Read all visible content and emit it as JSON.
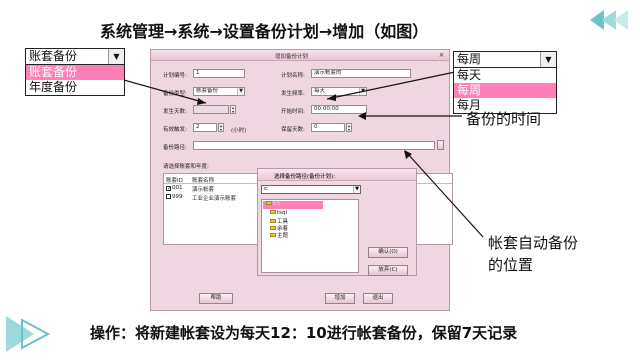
{
  "title": "系统管理→系统→设置备份计划→增加（如图）",
  "footer": "操作：将新建帐套设为每天12：10进行帐套备份，保留7天记录",
  "annotations": {
    "backup_time": "备份的时间",
    "backup_location_line1": "帐套自动备份",
    "backup_location_line2": "的位置"
  },
  "type_dropdown": {
    "selected": "账套备份",
    "options": [
      {
        "label": "账套备份",
        "selected": true
      },
      {
        "label": "年度备份",
        "selected": false
      }
    ]
  },
  "freq_dropdown": {
    "selected": "每周",
    "options": [
      {
        "label": "每天",
        "selected": false
      },
      {
        "label": "每周",
        "selected": true
      },
      {
        "label": "每月",
        "selected": false
      }
    ]
  },
  "dialog": {
    "title": "增加备份计划",
    "close": "×",
    "plan_code_label": "计划编号:",
    "plan_code_value": "1",
    "plan_name_label": "计划名称:",
    "plan_name_value": "演示帐套的",
    "backup_type_label": "备份类型:",
    "backup_type_value": "账套备份",
    "freq_label": "发生频率:",
    "freq_value": "每天",
    "days_label": "发生天数:",
    "days_value": "",
    "start_time_label": "开始时间:",
    "start_time_value": "00:00:00",
    "valid_label": "有效触发:",
    "valid_value": "2",
    "valid_unit": "(小时)",
    "keep_days_label": "保留天数:",
    "keep_days_value": "0",
    "path_label": "备份路径:",
    "path_value": "",
    "select_label": "请选择账套和年度:",
    "table": {
      "headers": [
        "账套ID",
        "账套名称"
      ],
      "rows": [
        {
          "checked": "✓",
          "id": "001",
          "name": "演示帐套"
        },
        {
          "checked": "",
          "id": "999",
          "name": "工业企业演示账套"
        }
      ]
    },
    "help_button": "帮助",
    "add_button": "增加",
    "exit_button": "退出"
  },
  "path_dialog": {
    "title": "选择备份路径(备份计划):",
    "drive": "c:",
    "tree": [
      "c:\\",
      "tsql",
      "工具",
      "余着",
      "主题"
    ],
    "ok_button": "确认(O)",
    "cancel_button": "放弃(C)"
  },
  "colors": {
    "dialog_bg": "#efd7e1",
    "selected_option": "#ff7fb8",
    "deco_teal": "#6cc3c7"
  }
}
